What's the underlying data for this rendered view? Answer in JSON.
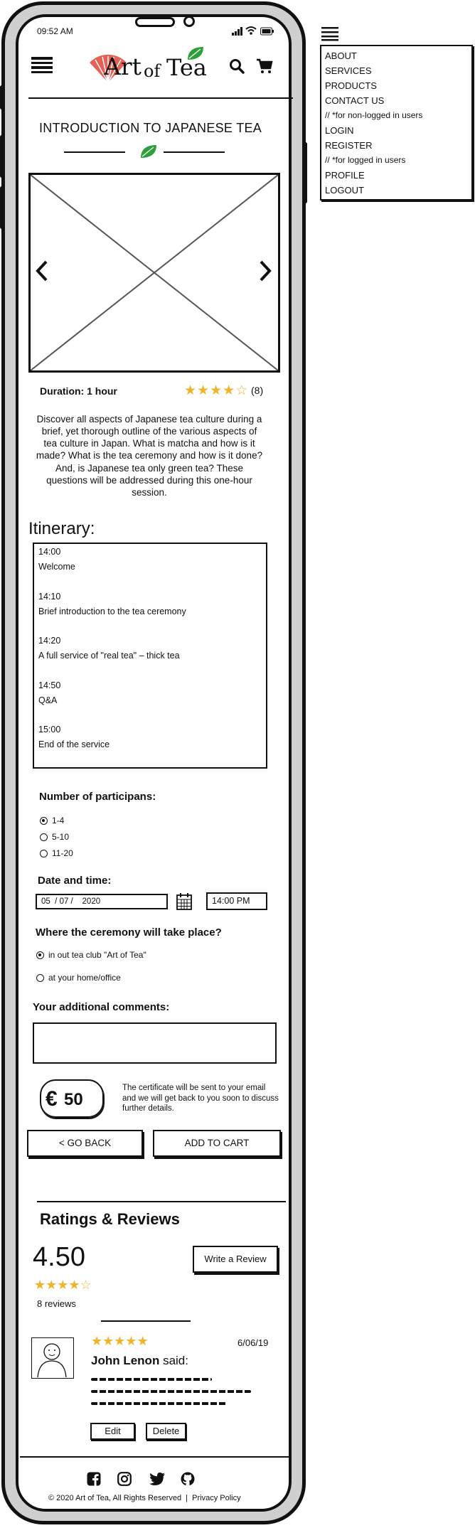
{
  "status_bar": {
    "time": "09:52 AM"
  },
  "header": {
    "logo": {
      "text_art": "Art",
      "text_of": "of",
      "text_tea": "Tea"
    }
  },
  "menu": {
    "items": [
      "ABOUT",
      "SERVICES",
      "PRODUCTS",
      "CONTACT US",
      "// *for non-logged in users",
      "LOGIN",
      "REGISTER",
      "// *for logged in users",
      "PROFILE",
      "LOGOUT"
    ]
  },
  "page": {
    "title": "INTRODUCTION TO JAPANESE TEA",
    "duration": "Duration: 1 hour",
    "rating_count": "(8)",
    "rating_value": 3.5,
    "description": "Discover all aspects of Japanese tea culture during a brief, yet thorough outline of the various aspects of tea culture in Japan. What is matcha and how is it made? What is the tea ceremony and how is it done? And, is Japanese tea only green tea? These questions will be addressed during this one-hour session."
  },
  "itinerary": {
    "heading": "Itinerary:",
    "entries": [
      {
        "time": "14:00",
        "label": "Welcome"
      },
      {
        "time": "14:10",
        "label": "Brief introduction to the tea ceremony"
      },
      {
        "time": "14:20",
        "label": "A full service of \"real tea\" – thick tea"
      },
      {
        "time": "14:50",
        "label": "Q&A"
      },
      {
        "time": "15:00",
        "label": "End of the service"
      }
    ]
  },
  "booking": {
    "participants_label": "Number of participanes:",
    "participants_label_exact": "Number of participans:",
    "participants_options": [
      "1-4",
      "5-10",
      "11-20"
    ],
    "participants_selected": "1-4",
    "datetime_label": "Date and time:",
    "date_value": "05  / 07 /    2020",
    "time_value": "14:00 PM",
    "location_label": "Where the ceremony will take place?",
    "location_options": [
      "in out tea club \"Art of Tea\"",
      "at your home/office"
    ],
    "location_selected": "in out tea club \"Art of Tea\"",
    "comments_label": "Your additional comments:",
    "comments_value": "",
    "price": "50",
    "currency": "€",
    "certificate_note": "The certificate will be sent to your email and we will get back to you soon to discuss further details.",
    "back_button": "< GO BACK",
    "cart_button": "ADD TO CART"
  },
  "reviews": {
    "heading": "Ratings & Reviews",
    "average": "4.50",
    "average_stars": 4,
    "count_text": "8 reviews",
    "write_button": "Write a Review",
    "items": [
      {
        "date": "6/06/19",
        "author": "John Lenon",
        "said": "said:",
        "stars": 5,
        "edit": "Edit",
        "delete": "Delete"
      }
    ]
  },
  "footer": {
    "copyright": "© 2020 Art of Tea, All Rights Reserved  |  Privacy Policy"
  },
  "colors": {
    "star": "#f0b429",
    "leaf": "#2e9e3a",
    "logo_red": "#e0443a"
  }
}
